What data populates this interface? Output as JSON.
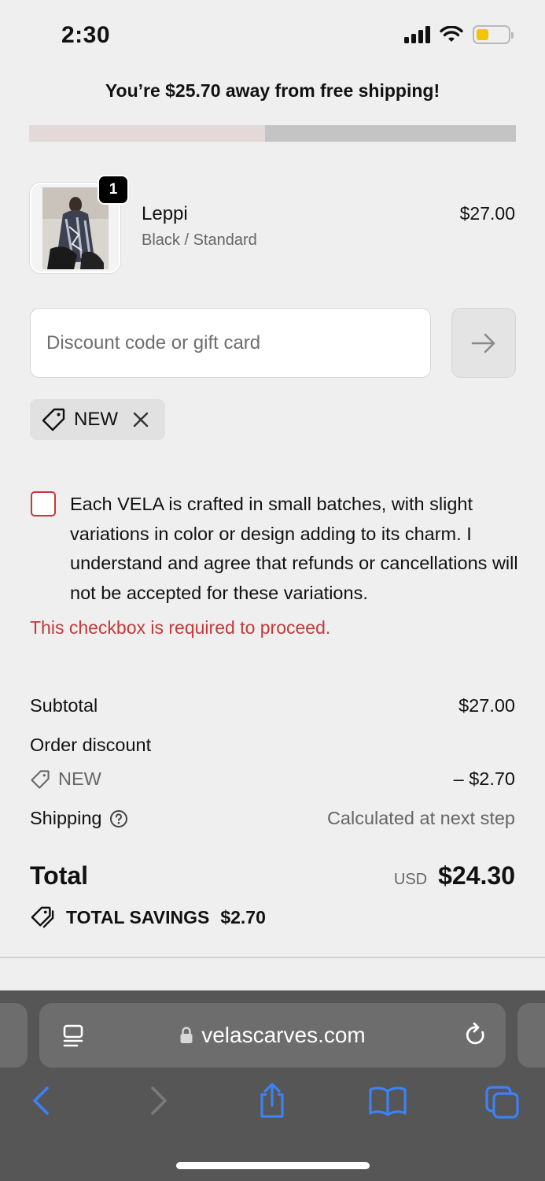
{
  "status_bar": {
    "time": "2:30"
  },
  "banner": {
    "message": "You’re $25.70 away from free shipping!",
    "progress_fraction": 0.485
  },
  "line_item": {
    "quantity": "1",
    "name": "Leppi",
    "variant": "Black / Standard",
    "price": "$27.00",
    "image": "product-photo"
  },
  "discount": {
    "placeholder": "Discount code or gift card",
    "value": "",
    "applied_code": "NEW"
  },
  "consent": {
    "text": "Each VELA is crafted in small batches, with slight variations in color or design adding to its charm. I understand and agree that refunds or cancellations will not be accepted for these variations.",
    "checked": false,
    "error": "This checkbox is required to proceed."
  },
  "summary": {
    "subtotal_label": "Subtotal",
    "subtotal_value": "$27.00",
    "order_discount_label": "Order discount",
    "discount_code": "NEW",
    "discount_value": "– $2.70",
    "shipping_label": "Shipping",
    "shipping_value": "Calculated at next step",
    "total_label": "Total",
    "currency": "USD",
    "total_value": "$24.30",
    "savings_label": "TOTAL SAVINGS",
    "savings_value": "$2.70"
  },
  "browser": {
    "url": "velascarves.com"
  },
  "colors": {
    "accent": "#3478f6",
    "error": "#c23a3a",
    "battery": "#f5c400",
    "progress_fill": "#e3d9d9",
    "progress_track": "#c4c4c4"
  },
  "icons": [
    "signal-icon",
    "wifi-icon",
    "battery-icon",
    "arrow-right-icon",
    "tag-icon",
    "close-icon",
    "help-circle-icon",
    "tags-icon",
    "reader-icon",
    "lock-icon",
    "reload-icon",
    "back-icon",
    "forward-icon",
    "share-icon",
    "bookmarks-icon",
    "tabs-icon"
  ]
}
